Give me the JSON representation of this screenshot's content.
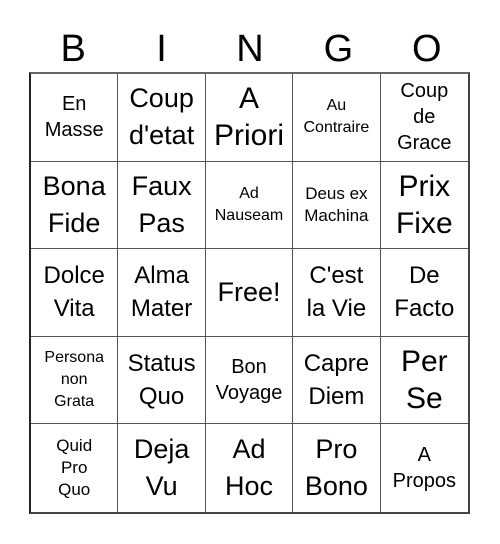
{
  "header": {
    "letters": [
      "B",
      "I",
      "N",
      "G",
      "O"
    ]
  },
  "cells": [
    [
      "En\nMasse",
      "Coup\nd'etat",
      "A\nPriori",
      "Au\nContraire",
      "Coup\nde\nGrace"
    ],
    [
      "Bona\nFide",
      "Faux\nPas",
      "Ad\nNauseam",
      "Deus ex\nMachina",
      "Prix\nFixe"
    ],
    [
      "Dolce\nVita",
      "Alma\nMater",
      "Free!",
      "C'est\nla Vie",
      "De\nFacto"
    ],
    [
      "Persona\nnon\nGrata",
      "Status\nQuo",
      "Bon\nVoyage",
      "Capre\nDiem",
      "Per\nSe"
    ],
    [
      "Quid\nPro\nQuo",
      "Deja\nVu",
      "Ad\nHoc",
      "Pro\nBono",
      "A\nPropos"
    ]
  ]
}
